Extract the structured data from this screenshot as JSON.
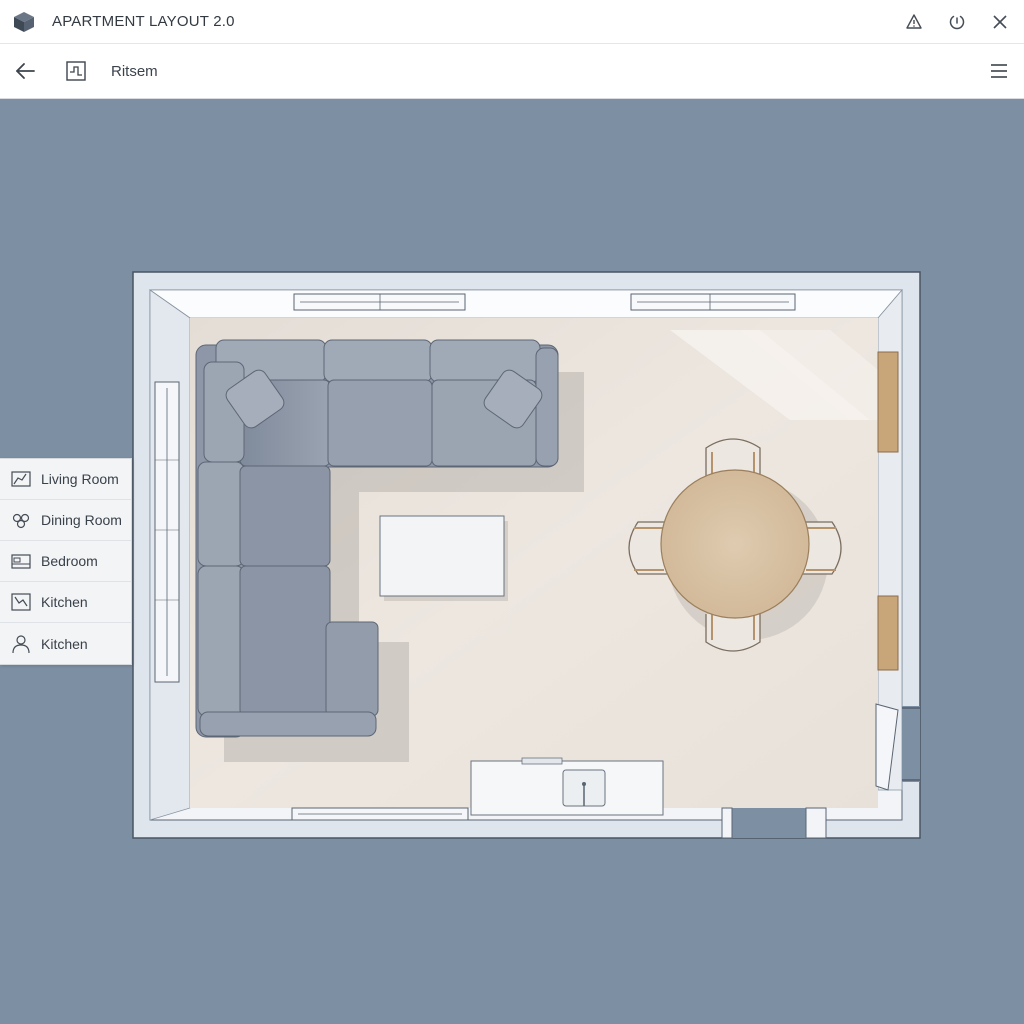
{
  "app": {
    "title": "APARTMENT LAYOUT 2.0",
    "logo_icon": "isometric-cube-icon",
    "window_controls": [
      "warning-icon",
      "power-icon",
      "close-icon"
    ]
  },
  "toolbar": {
    "back_icon": "arrow-left-icon",
    "plan_icon": "floorplan-icon",
    "label": "Ritsem",
    "menu_icon": "hamburger-menu-icon"
  },
  "room_menu": {
    "items": [
      {
        "label": "Living Room",
        "icon": "room-outline-icon"
      },
      {
        "label": "Dining Room",
        "icon": "circles-icon"
      },
      {
        "label": "Bedroom",
        "icon": "bed-icon"
      },
      {
        "label": "Kitchen",
        "icon": "kitchen-plan-icon"
      },
      {
        "label": "Kitchen",
        "icon": "person-icon"
      }
    ]
  },
  "colors": {
    "canvas_bg": "#7d8fa3",
    "wall": "#eef1f5",
    "floor": "#ebe4dc",
    "sofa": "#8e98a8",
    "table_wood": "#d9c3a5",
    "accent_wood": "#c9a57a"
  }
}
